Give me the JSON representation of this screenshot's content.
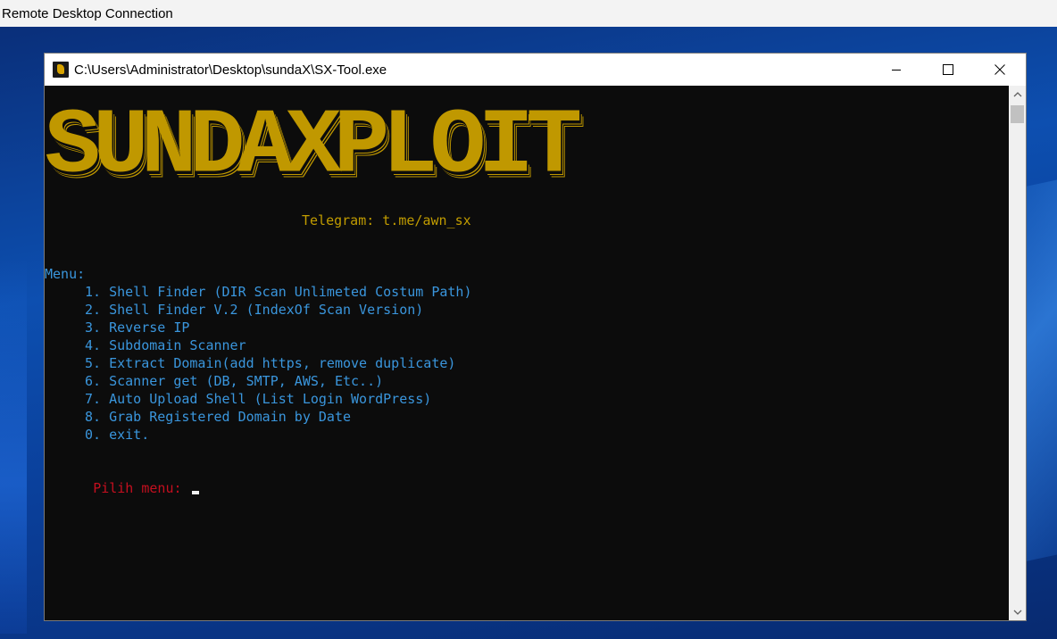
{
  "rdp": {
    "title": "Remote Desktop Connection"
  },
  "window": {
    "title": "C:\\Users\\Administrator\\Desktop\\sundaX\\SX-Tool.exe",
    "icon": "sx-tool-app-icon",
    "controls": [
      "minimize-icon",
      "maximize-icon",
      "close-icon"
    ]
  },
  "console": {
    "banner": "SUNDAXPLOIT",
    "telegram": "Telegram: t.me/awn_sx",
    "menu_header": "Menu:",
    "menu_items": [
      "1. Shell Finder (DIR Scan Unlimeted Costum Path)",
      "2. Shell Finder V.2 (IndexOf Scan Version)",
      "3. Reverse IP",
      "4. Subdomain Scanner",
      "5. Extract Domain(add https, remove duplicate)",
      "6. Scanner get (DB, SMTP, AWS, Etc..)",
      "7. Auto Upload Shell (List Login WordPress)",
      "8. Grab Registered Domain by Date",
      "0. exit."
    ],
    "prompt": "Pilih menu: "
  },
  "colors": {
    "console_bg": "#0c0c0c",
    "banner": "#c09800",
    "menu": "#3a96dd",
    "prompt": "#c50f1f"
  }
}
